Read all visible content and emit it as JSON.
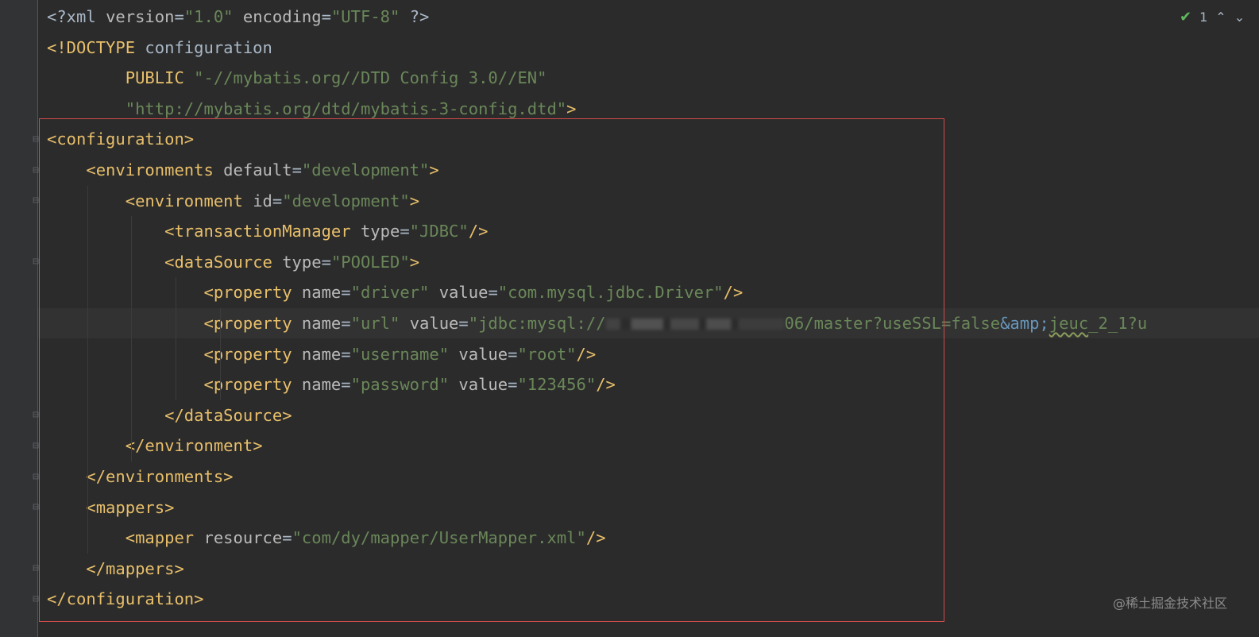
{
  "editor": {
    "lines": [
      [
        {
          "t": "plain",
          "v": "<?xml "
        },
        {
          "t": "attr",
          "v": "version"
        },
        {
          "t": "plain",
          "v": "="
        },
        {
          "t": "val",
          "v": "\"1.0\""
        },
        {
          "t": "plain",
          "v": " "
        },
        {
          "t": "attr",
          "v": "encoding"
        },
        {
          "t": "plain",
          "v": "="
        },
        {
          "t": "val",
          "v": "\"UTF-8\""
        },
        {
          "t": "plain",
          "v": " ?>"
        }
      ],
      [
        {
          "t": "tag",
          "v": "<!DOCTYPE "
        },
        {
          "t": "plain",
          "v": "configuration"
        }
      ],
      [
        {
          "t": "plain",
          "v": "        "
        },
        {
          "t": "tag",
          "v": "PUBLIC"
        },
        {
          "t": "plain",
          "v": " "
        },
        {
          "t": "val",
          "v": "\"-//mybatis.org//DTD Config 3.0//EN\""
        }
      ],
      [
        {
          "t": "plain",
          "v": "        "
        },
        {
          "t": "val",
          "v": "\"http://mybatis.org/dtd/mybatis-3-config.dtd\""
        },
        {
          "t": "tag",
          "v": ">"
        }
      ],
      [
        {
          "t": "tag",
          "v": "<configuration>"
        }
      ],
      [
        {
          "t": "plain",
          "v": "    "
        },
        {
          "t": "tag",
          "v": "<environments "
        },
        {
          "t": "attr",
          "v": "default"
        },
        {
          "t": "plain",
          "v": "="
        },
        {
          "t": "val",
          "v": "\"development\""
        },
        {
          "t": "tag",
          "v": ">"
        }
      ],
      [
        {
          "t": "plain",
          "v": "        "
        },
        {
          "t": "tag",
          "v": "<environment "
        },
        {
          "t": "attr",
          "v": "id"
        },
        {
          "t": "plain",
          "v": "="
        },
        {
          "t": "val",
          "v": "\"development\""
        },
        {
          "t": "tag",
          "v": ">"
        }
      ],
      [
        {
          "t": "plain",
          "v": "            "
        },
        {
          "t": "tag",
          "v": "<transactionManager "
        },
        {
          "t": "attr",
          "v": "type"
        },
        {
          "t": "plain",
          "v": "="
        },
        {
          "t": "val",
          "v": "\"JDBC\""
        },
        {
          "t": "tag",
          "v": "/>"
        }
      ],
      [
        {
          "t": "plain",
          "v": "            "
        },
        {
          "t": "tag",
          "v": "<dataSource "
        },
        {
          "t": "attr",
          "v": "type"
        },
        {
          "t": "plain",
          "v": "="
        },
        {
          "t": "val",
          "v": "\"POOLED\""
        },
        {
          "t": "tag",
          "v": ">"
        }
      ],
      [
        {
          "t": "plain",
          "v": "                "
        },
        {
          "t": "tag",
          "v": "<property "
        },
        {
          "t": "attr",
          "v": "name"
        },
        {
          "t": "plain",
          "v": "="
        },
        {
          "t": "val",
          "v": "\"driver\""
        },
        {
          "t": "plain",
          "v": " "
        },
        {
          "t": "attr",
          "v": "value"
        },
        {
          "t": "plain",
          "v": "="
        },
        {
          "t": "val",
          "v": "\"com.mysql.jdbc.Driver\""
        },
        {
          "t": "tag",
          "v": "/>"
        }
      ],
      [
        {
          "t": "plain",
          "v": "                "
        },
        {
          "t": "tag",
          "v": "<property "
        },
        {
          "t": "attr",
          "v": "name"
        },
        {
          "t": "plain",
          "v": "="
        },
        {
          "t": "val",
          "v": "\"url\""
        },
        {
          "t": "plain",
          "v": " "
        },
        {
          "t": "attr",
          "v": "value"
        },
        {
          "t": "plain",
          "v": "="
        },
        {
          "t": "val",
          "v": "\"jdbc:mysql://"
        },
        {
          "t": "blur",
          "v": ""
        },
        {
          "t": "val",
          "v": "06/master?useSSL=false"
        },
        {
          "t": "ent",
          "v": "&amp;"
        },
        {
          "t": "squiggle",
          "v": "jeuc"
        },
        {
          "t": "val",
          "v": "_2_1?u"
        }
      ],
      [
        {
          "t": "plain",
          "v": "                "
        },
        {
          "t": "tag",
          "v": "<property "
        },
        {
          "t": "attr",
          "v": "name"
        },
        {
          "t": "plain",
          "v": "="
        },
        {
          "t": "val",
          "v": "\"username\""
        },
        {
          "t": "plain",
          "v": " "
        },
        {
          "t": "attr",
          "v": "value"
        },
        {
          "t": "plain",
          "v": "="
        },
        {
          "t": "val",
          "v": "\"root\""
        },
        {
          "t": "tag",
          "v": "/>"
        }
      ],
      [
        {
          "t": "plain",
          "v": "                "
        },
        {
          "t": "tag",
          "v": "<property "
        },
        {
          "t": "attr",
          "v": "name"
        },
        {
          "t": "plain",
          "v": "="
        },
        {
          "t": "val",
          "v": "\"password\""
        },
        {
          "t": "plain",
          "v": " "
        },
        {
          "t": "attr",
          "v": "value"
        },
        {
          "t": "plain",
          "v": "="
        },
        {
          "t": "val",
          "v": "\"123456\""
        },
        {
          "t": "tag",
          "v": "/>"
        }
      ],
      [
        {
          "t": "plain",
          "v": "            "
        },
        {
          "t": "tag",
          "v": "</dataSource>"
        }
      ],
      [
        {
          "t": "plain",
          "v": "        "
        },
        {
          "t": "tag",
          "v": "</environment>"
        }
      ],
      [
        {
          "t": "plain",
          "v": "    "
        },
        {
          "t": "tag",
          "v": "</environments>"
        }
      ],
      [
        {
          "t": "plain",
          "v": "    "
        },
        {
          "t": "tag",
          "v": "<mappers>"
        }
      ],
      [
        {
          "t": "plain",
          "v": "        "
        },
        {
          "t": "tag",
          "v": "<mapper "
        },
        {
          "t": "attr",
          "v": "resource"
        },
        {
          "t": "plain",
          "v": "="
        },
        {
          "t": "val",
          "v": "\"com/dy/mapper/UserMapper.xml\""
        },
        {
          "t": "tag",
          "v": "/>"
        }
      ],
      [
        {
          "t": "plain",
          "v": "    "
        },
        {
          "t": "tag",
          "v": "</mappers>"
        }
      ],
      [
        {
          "t": "tag",
          "v": "</configuration>"
        }
      ]
    ],
    "current_line": 10,
    "fold_open_lines": [
      4,
      5,
      6,
      8,
      16
    ],
    "fold_close_lines": [
      13,
      14,
      15,
      18,
      19
    ]
  },
  "inspection": {
    "icon": "check-icon",
    "count": "1",
    "prev_icon": "chevron-up-icon",
    "next_icon": "chevron-down-icon"
  },
  "watermark": "@稀土掘金技术社区",
  "colors": {
    "background": "#2b2b2b",
    "tag": "#e8bf6a",
    "attribute": "#bababa",
    "string": "#6a8759",
    "entity": "#6897bb",
    "selection_border": "#d24b4b"
  }
}
